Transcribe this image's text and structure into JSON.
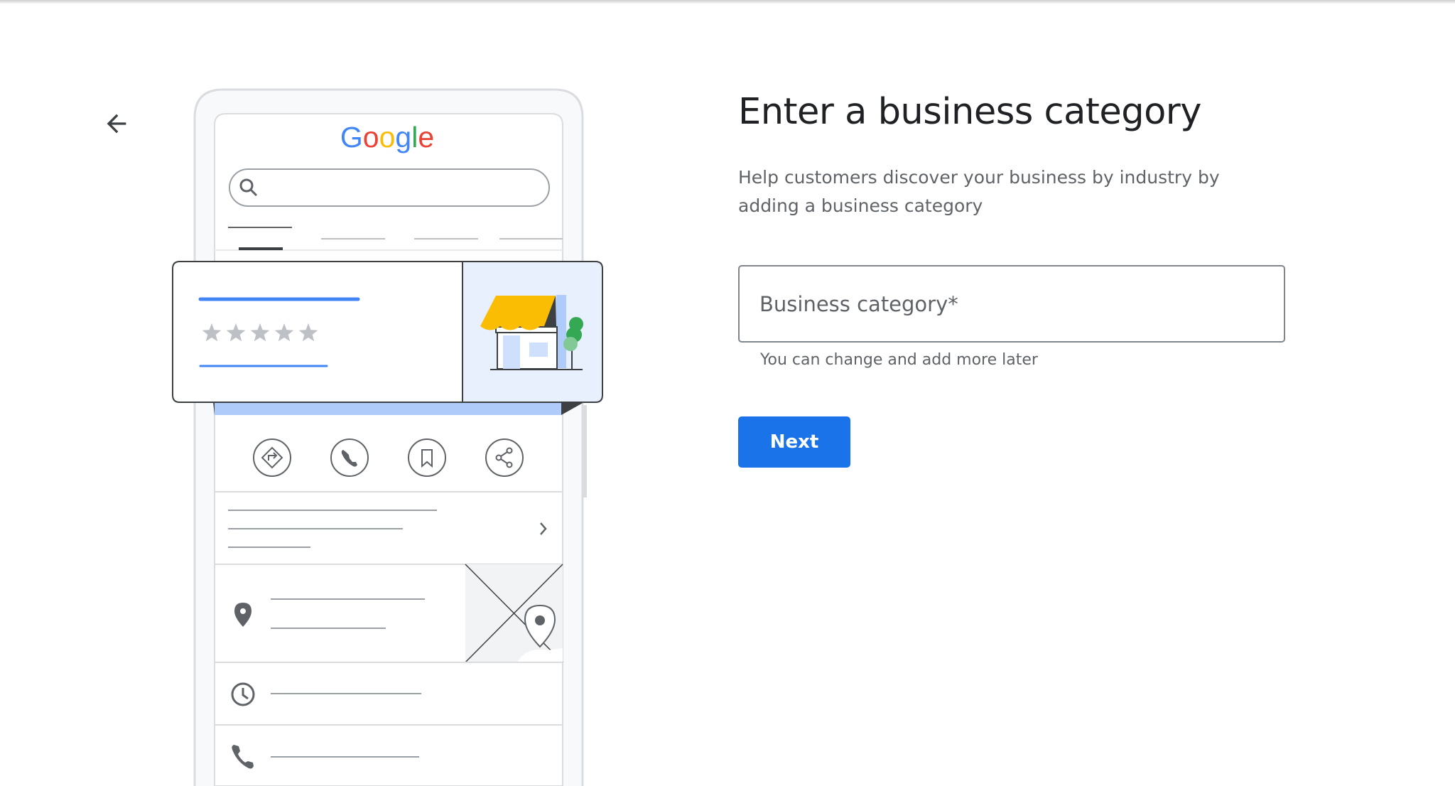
{
  "header": {
    "back_icon": "arrow-back-icon"
  },
  "illustration": {
    "logo_text": "Google",
    "logo_colors": [
      "#4285F4",
      "#EA4335",
      "#FBBC05",
      "#4285F4",
      "#34A853",
      "#EA4335"
    ],
    "rating_stars": 5,
    "icons": [
      "search-icon",
      "directions-icon",
      "phone-icon",
      "bookmark-icon",
      "share-icon",
      "chevron-right-icon",
      "location-pin-icon",
      "clock-icon",
      "phone-icon"
    ]
  },
  "main": {
    "title": "Enter a business category",
    "description": "Help customers discover your business by industry by adding a business category",
    "category_field": {
      "placeholder": "Business category*",
      "value": ""
    },
    "helper_text": "You can change and add more later",
    "next_label": "Next"
  },
  "colors": {
    "primary": "#1a73e8",
    "text_primary": "#202124",
    "text_secondary": "#5f6368",
    "accent_yellow": "#fbbc04",
    "card_blue": "#e8f0fe"
  }
}
